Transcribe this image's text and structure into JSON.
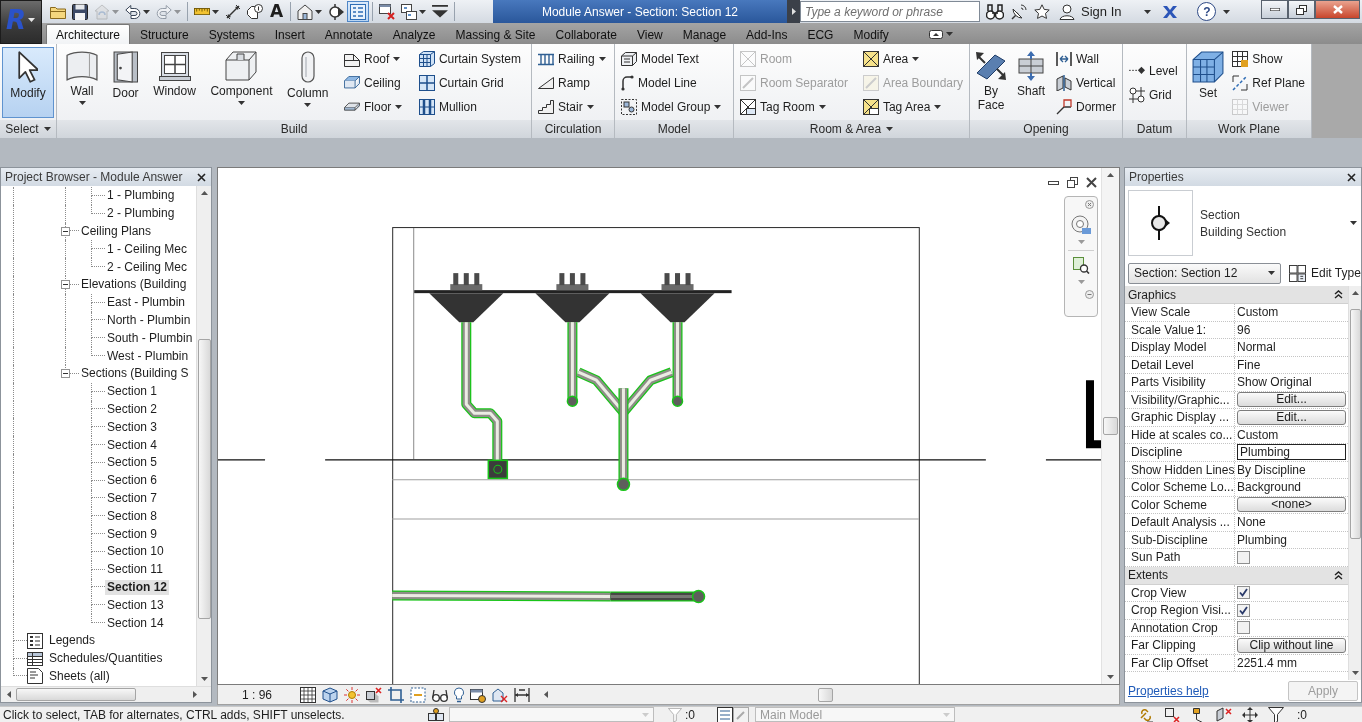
{
  "window": {
    "title": "Module Answer - Section: Section 12"
  },
  "app_menu": {
    "glyph": "R"
  },
  "quick_access": [
    [
      {
        "has_menu": false,
        "on": false,
        "disabled": false
      },
      {
        "has_menu": false,
        "on": false,
        "disabled": false
      },
      {
        "has_menu": true,
        "on": false,
        "disabled": true
      },
      {
        "has_menu": true,
        "on": false,
        "disabled": false
      },
      {
        "has_menu": true,
        "on": false,
        "disabled": true
      }
    ],
    [
      {
        "has_menu": true,
        "on": false,
        "disabled": false
      },
      {
        "has_menu": false,
        "on": false,
        "disabled": false
      },
      {
        "has_menu": false,
        "on": false,
        "disabled": false
      },
      {
        "glyph": "A",
        "has_menu": false,
        "on": false,
        "disabled": false
      }
    ],
    [
      {
        "has_menu": true,
        "on": false,
        "disabled": false
      },
      {
        "has_menu": false,
        "on": false,
        "disabled": false
      },
      {
        "has_menu": false,
        "on": true,
        "disabled": false
      }
    ],
    [
      {
        "has_menu": false,
        "on": false,
        "disabled": false
      },
      {
        "has_menu": true,
        "on": false,
        "disabled": false
      },
      {
        "has_menu": false,
        "on": false,
        "disabled": false
      }
    ]
  ],
  "search": {
    "placeholder": "Type a keyword or phrase"
  },
  "account": {
    "label": "Sign In"
  },
  "help": {
    "glyph": "?"
  },
  "ribbon_tabs": [
    {
      "label": "Architecture",
      "selected": true
    },
    {
      "label": "Structure",
      "selected": false
    },
    {
      "label": "Systems",
      "selected": false
    },
    {
      "label": "Insert",
      "selected": false
    },
    {
      "label": "Annotate",
      "selected": false
    },
    {
      "label": "Analyze",
      "selected": false
    },
    {
      "label": "Massing & Site",
      "selected": false
    },
    {
      "label": "Collaborate",
      "selected": false
    },
    {
      "label": "View",
      "selected": false
    },
    {
      "label": "Manage",
      "selected": false
    },
    {
      "label": "Add-Ins",
      "selected": false
    },
    {
      "label": "ECG",
      "selected": false
    },
    {
      "label": "Modify",
      "selected": false
    }
  ],
  "ribbon_panels": [
    {
      "title": "Select",
      "has_menu": true,
      "tools": [
        {
          "label": "Modify",
          "kind": "large",
          "on": true,
          "disabled": false,
          "has_menu": false
        }
      ]
    },
    {
      "title": "Build",
      "has_menu": false,
      "tools": [
        {
          "label": "Wall",
          "kind": "large",
          "on": false,
          "disabled": false,
          "has_menu": true
        },
        {
          "label": "Door",
          "kind": "large",
          "on": false,
          "disabled": false,
          "has_menu": false
        },
        {
          "label": "Window",
          "kind": "large",
          "on": false,
          "disabled": false,
          "has_menu": false
        },
        {
          "label": "Component",
          "kind": "large",
          "on": false,
          "disabled": false,
          "has_menu": true
        },
        {
          "label": "Column",
          "kind": "large",
          "on": false,
          "disabled": false,
          "has_menu": true
        },
        {
          "label": "Roof",
          "kind": "small",
          "on": false,
          "disabled": false,
          "has_menu": true
        },
        {
          "label": "Ceiling",
          "kind": "small",
          "on": false,
          "disabled": false,
          "has_menu": false
        },
        {
          "label": "Floor",
          "kind": "small",
          "on": false,
          "disabled": false,
          "has_menu": true
        },
        {
          "label": "Curtain System",
          "kind": "small",
          "on": false,
          "disabled": false,
          "has_menu": false
        },
        {
          "label": "Curtain Grid",
          "kind": "small",
          "on": false,
          "disabled": false,
          "has_menu": false
        },
        {
          "label": "Mullion",
          "kind": "small",
          "on": false,
          "disabled": false,
          "has_menu": false
        }
      ]
    },
    {
      "title": "Circulation",
      "has_menu": false,
      "tools": [
        {
          "label": "Railing",
          "kind": "small",
          "on": false,
          "disabled": false,
          "has_menu": true
        },
        {
          "label": "Ramp",
          "kind": "small",
          "on": false,
          "disabled": false,
          "has_menu": false
        },
        {
          "label": "Stair",
          "kind": "small",
          "on": false,
          "disabled": false,
          "has_menu": true
        }
      ]
    },
    {
      "title": "Model",
      "has_menu": false,
      "tools": [
        {
          "label": "Model Text",
          "kind": "small",
          "on": false,
          "disabled": false,
          "has_menu": false
        },
        {
          "label": "Model Line",
          "kind": "small",
          "on": false,
          "disabled": false,
          "has_menu": false
        },
        {
          "label": "Model Group",
          "kind": "small",
          "on": false,
          "disabled": false,
          "has_menu": true
        }
      ]
    },
    {
      "title": "Room & Area",
      "has_menu": true,
      "tools": [
        {
          "label": "Room",
          "kind": "small",
          "on": false,
          "disabled": true,
          "has_menu": false
        },
        {
          "label": "Room Separator",
          "kind": "small",
          "on": false,
          "disabled": true,
          "has_menu": false
        },
        {
          "label": "Tag Room",
          "kind": "small",
          "on": false,
          "disabled": false,
          "has_menu": true
        },
        {
          "label": "Area",
          "kind": "small",
          "on": false,
          "disabled": false,
          "has_menu": true
        },
        {
          "label": "Area Boundary",
          "kind": "small",
          "on": false,
          "disabled": true,
          "has_menu": false
        },
        {
          "label": "Tag Area",
          "kind": "small",
          "on": false,
          "disabled": false,
          "has_menu": true
        }
      ]
    },
    {
      "title": "Opening",
      "has_menu": false,
      "tools": [
        {
          "label": "By Face",
          "kind": "large",
          "on": false,
          "disabled": false,
          "has_menu": false
        },
        {
          "label": "Shaft",
          "kind": "large",
          "on": false,
          "disabled": false,
          "has_menu": false
        },
        {
          "label": "Wall",
          "kind": "small",
          "on": false,
          "disabled": false,
          "has_menu": false
        },
        {
          "label": "Vertical",
          "kind": "small",
          "on": false,
          "disabled": false,
          "has_menu": false
        },
        {
          "label": "Dormer",
          "kind": "small",
          "on": false,
          "disabled": false,
          "has_menu": false
        }
      ]
    },
    {
      "title": "Datum",
      "has_menu": false,
      "tools": [
        {
          "label": "Level",
          "kind": "small",
          "on": false,
          "disabled": false,
          "has_menu": false
        },
        {
          "label": "Grid",
          "kind": "small",
          "on": false,
          "disabled": false,
          "has_menu": false
        }
      ]
    },
    {
      "title": "Work Plane",
      "has_menu": false,
      "tools": [
        {
          "label": "Set",
          "kind": "large",
          "on": false,
          "disabled": false,
          "has_menu": false
        },
        {
          "label": "Show",
          "kind": "small",
          "on": false,
          "disabled": false,
          "has_menu": false
        },
        {
          "label": "Ref Plane",
          "kind": "small",
          "on": false,
          "disabled": false,
          "has_menu": false
        },
        {
          "label": "Viewer",
          "kind": "small",
          "on": false,
          "disabled": true,
          "has_menu": false
        }
      ]
    }
  ],
  "project_browser": {
    "title": "Project Browser - Module Answer",
    "tree": [
      {
        "children": [
          {
            "children": [
              {
                "children": [
                  {
                    "label": "1 - Plumbing",
                    "selected": false
                  },
                  {
                    "label": "2 - Plumbing",
                    "selected": false
                  }
                ]
              },
              {
                "label": "Ceiling Plans",
                "expanded": true,
                "selected": false,
                "children": [
                  {
                    "label": "1 - Ceiling Mec",
                    "selected": false
                  },
                  {
                    "label": "2 - Ceiling Mec",
                    "selected": false
                  }
                ]
              },
              {
                "label": "Elevations (Building",
                "expanded": true,
                "selected": false,
                "children": [
                  {
                    "label": "East - Plumbin",
                    "selected": false
                  },
                  {
                    "label": "North - Plumbin",
                    "selected": false
                  },
                  {
                    "label": "South - Plumbin",
                    "selected": false
                  },
                  {
                    "label": "West - Plumbin",
                    "selected": false
                  }
                ]
              },
              {
                "label": "Sections (Building S",
                "expanded": true,
                "selected": false,
                "children": [
                  {
                    "label": "Section 1",
                    "selected": false
                  },
                  {
                    "label": "Section 2",
                    "selected": false
                  },
                  {
                    "label": "Section 3",
                    "selected": false
                  },
                  {
                    "label": "Section 4",
                    "selected": false
                  },
                  {
                    "label": "Section 5",
                    "selected": false
                  },
                  {
                    "label": "Section 6",
                    "selected": false
                  },
                  {
                    "label": "Section 7",
                    "selected": false
                  },
                  {
                    "label": "Section 8",
                    "selected": false
                  },
                  {
                    "label": "Section 9",
                    "selected": false
                  },
                  {
                    "label": "Section 10",
                    "selected": false
                  },
                  {
                    "label": "Section 11",
                    "selected": false
                  },
                  {
                    "label": "Section 12",
                    "selected": true
                  },
                  {
                    "label": "Section 13",
                    "selected": false
                  },
                  {
                    "label": "Section 14",
                    "selected": false
                  }
                ]
              }
            ]
          }
        ]
      },
      {
        "label": "Legends",
        "selected": false
      },
      {
        "label": "Schedules/Quantities",
        "selected": false
      },
      {
        "label": "Sheets (all)",
        "selected": false
      }
    ]
  },
  "view": {
    "scale": "1 : 96"
  },
  "properties": {
    "title": "Properties",
    "type": {
      "family": "Section",
      "name": "Building Section"
    },
    "instance": "Section: Section 12",
    "edit_type": "Edit Type",
    "groups": [
      {
        "title": "Graphics",
        "expanded": true,
        "rows": [
          {
            "name": "View Scale",
            "kind": "text",
            "value": "Custom"
          },
          {
            "name": "Scale Value",
            "unit": "1:",
            "kind": "text",
            "value": "96"
          },
          {
            "name": "Display Model",
            "kind": "text",
            "value": "Normal"
          },
          {
            "name": "Detail Level",
            "kind": "text",
            "value": "Fine"
          },
          {
            "name": "Parts Visibility",
            "kind": "text",
            "value": "Show Original"
          },
          {
            "name": "Visibility/Graphic...",
            "kind": "button",
            "value": "Edit..."
          },
          {
            "name": "Graphic Display ...",
            "kind": "button",
            "value": "Edit..."
          },
          {
            "name": "Hide at scales co...",
            "kind": "text",
            "value": "Custom"
          },
          {
            "name": "Discipline",
            "kind": "field",
            "value": "Plumbing"
          },
          {
            "name": "Show Hidden Lines",
            "kind": "text",
            "value": "By Discipline"
          },
          {
            "name": "Color Scheme Lo...",
            "kind": "text",
            "value": "Background"
          },
          {
            "name": "Color Scheme",
            "kind": "button",
            "value": "<none>"
          },
          {
            "name": "Default Analysis ...",
            "kind": "text",
            "value": "None"
          },
          {
            "name": "Sub-Discipline",
            "kind": "text",
            "value": "Plumbing"
          },
          {
            "name": "Sun Path",
            "kind": "checkbox",
            "checked": false
          }
        ]
      },
      {
        "title": "Extents",
        "expanded": true,
        "rows": [
          {
            "name": "Crop View",
            "kind": "checkbox",
            "checked": true
          },
          {
            "name": "Crop Region Visi...",
            "kind": "checkbox",
            "checked": true
          },
          {
            "name": "Annotation Crop",
            "kind": "checkbox",
            "checked": false
          },
          {
            "name": "Far Clipping",
            "kind": "button",
            "value": "Clip without line"
          },
          {
            "name": "Far Clip Offset",
            "kind": "text",
            "value": "2251.4 mm"
          }
        ]
      }
    ],
    "help_link": "Properties help",
    "apply": {
      "label": "Apply",
      "disabled": true
    }
  },
  "status_bar": {
    "message": "Click to select, TAB for alternates, CTRL adds, SHIFT unselects.",
    "workset": {
      "disabled": true
    },
    "filter_counts": [
      ":0",
      ":0"
    ],
    "design_option": {
      "value": "Main Model",
      "disabled": true
    }
  }
}
